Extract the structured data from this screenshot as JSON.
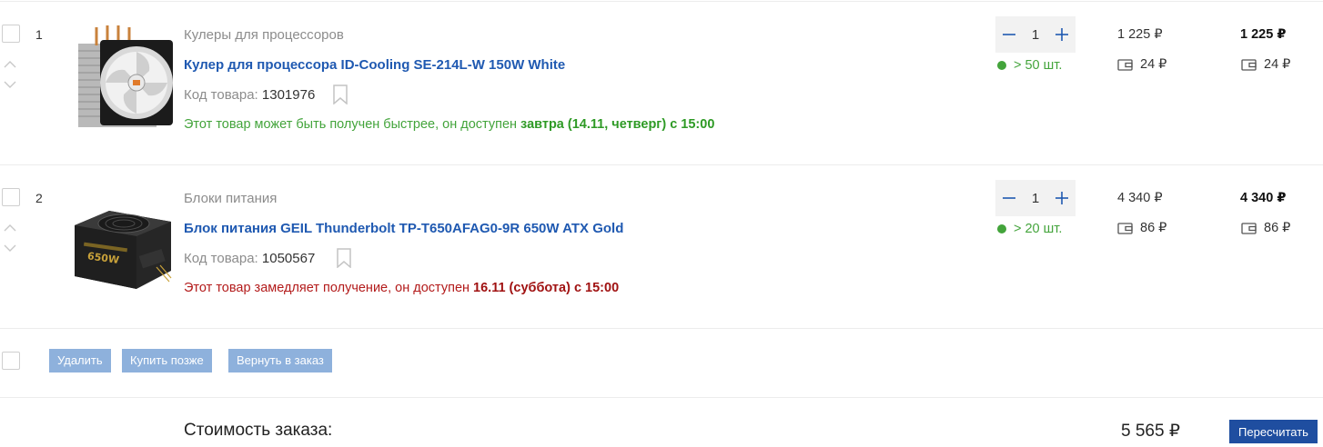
{
  "items": [
    {
      "num": "1",
      "category": "Кулеры для процессоров",
      "title": "Кулер для процессора ID-Cooling SE-214L-W 150W White",
      "code_label": "Код товара:",
      "code_value": "1301976",
      "avail_text": "Этот товар может быть получен быстрее, он доступен ",
      "avail_date": "завтра (14.11, четверг) с 15:00",
      "avail_status": "fast",
      "quantity": "1",
      "stock": "> 50 шт.",
      "price": "1 225 ₽",
      "price_bonus": "24 ₽",
      "sum": "1 225 ₽",
      "sum_bonus": "24 ₽",
      "image_icon": "cpu-cooler-image"
    },
    {
      "num": "2",
      "category": "Блоки питания",
      "title": "Блок питания GEIL Thunderbolt TP-T650AFAG0-9R 650W ATX Gold",
      "code_label": "Код товара:",
      "code_value": "1050567",
      "avail_text": "Этот товар замедляет получение, он доступен ",
      "avail_date": "16.11 (суббота) с 15:00",
      "avail_status": "slow",
      "quantity": "1",
      "stock": "> 20 шт.",
      "price": "4 340 ₽",
      "price_bonus": "86 ₽",
      "sum": "4 340 ₽",
      "sum_bonus": "86 ₽",
      "image_icon": "power-supply-image"
    }
  ],
  "bulk_actions": {
    "delete": "Удалить",
    "buy_later": "Купить позже",
    "return_to_order": "Вернуть в заказ"
  },
  "total": {
    "label": "Стоимость заказа:",
    "value": "5 565 ₽",
    "recalc": "Пересчитать"
  },
  "colors": {
    "link": "#1f59b1",
    "available_fast": "#43a43b",
    "available_slow": "#b31b1b",
    "bulk_button": "#8eb1dc",
    "primary_button": "#1f4ea0"
  }
}
